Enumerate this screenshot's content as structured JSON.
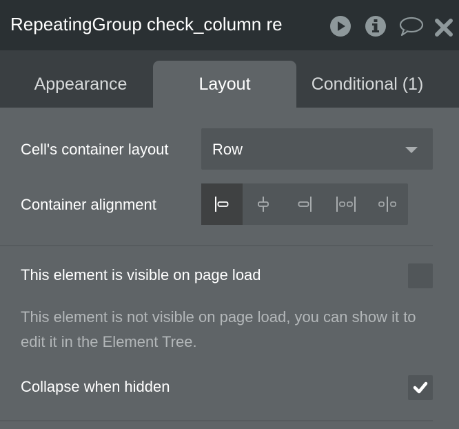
{
  "header": {
    "title": "RepeatingGroup check_column re",
    "icons": [
      "play-icon",
      "info-icon",
      "comment-icon",
      "close-icon"
    ]
  },
  "tabs": [
    {
      "label": "Appearance",
      "active": false
    },
    {
      "label": "Layout",
      "active": true
    },
    {
      "label": "Conditional (1)",
      "active": false
    }
  ],
  "layout": {
    "cell_container_label": "Cell's container layout",
    "cell_container_value": "Row",
    "alignment_label": "Container alignment",
    "alignment_options": [
      "align-left",
      "align-center",
      "align-right",
      "space-between",
      "space-around"
    ],
    "alignment_selected": "align-left"
  },
  "visibility": {
    "visible_label": "This element is visible on page load",
    "visible_checked": false,
    "hint": "This element is not visible on page load, you can show it to edit it in the Element Tree.",
    "collapse_label": "Collapse when hidden",
    "collapse_checked": true
  },
  "colors": {
    "header": "#2a3033",
    "tabbar": "#3a3f42",
    "panel": "#5f6467",
    "control": "#515659"
  }
}
